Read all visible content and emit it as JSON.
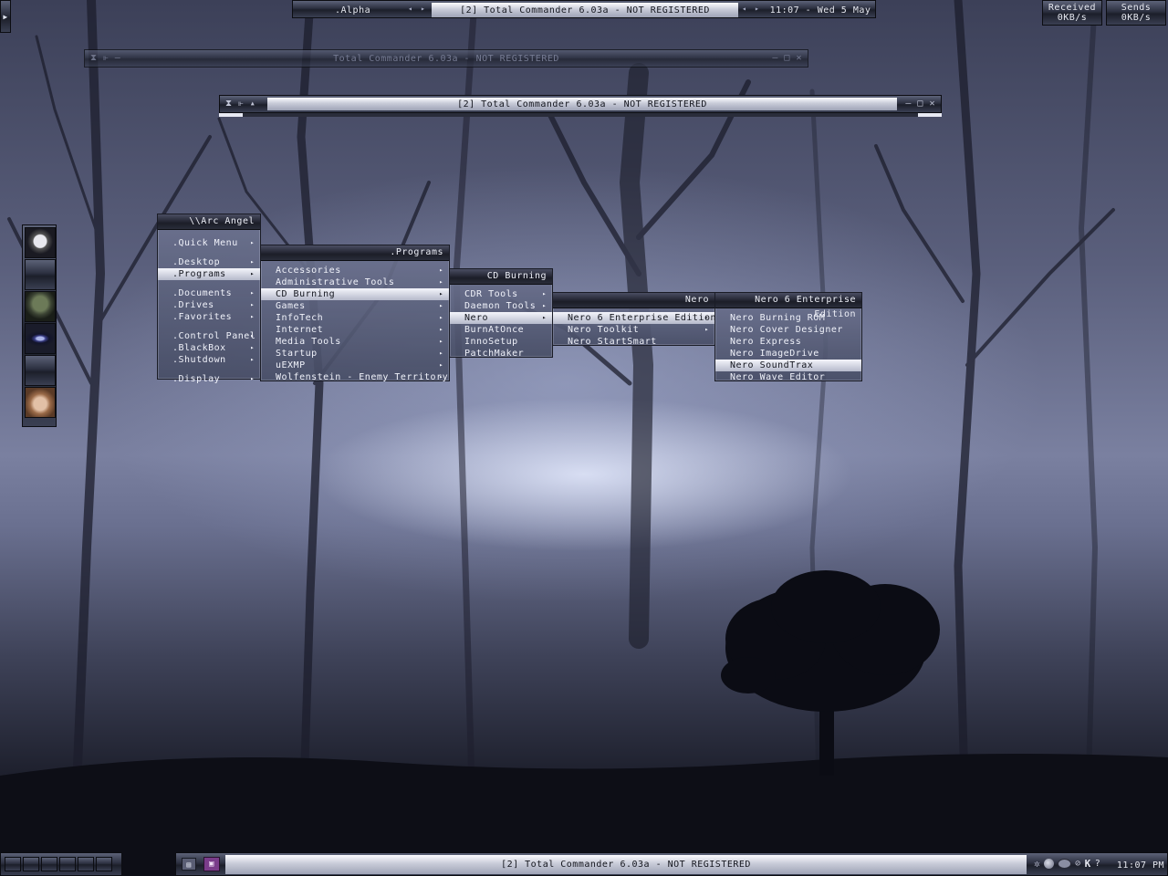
{
  "top_bar": {
    "workspace": ".Alpha",
    "window_title": "[2] Total Commander 6.03a - NOT REGISTERED",
    "clock": "11:07 - Wed 5 May"
  },
  "network": {
    "received_label": "Received",
    "received_value": "0KB/s",
    "sends_label": "Sends",
    "sends_value": "0KB/s"
  },
  "windows": [
    {
      "title": "Total Commander 6.03a - NOT REGISTERED"
    },
    {
      "title": "[2] Total Commander 6.03a - NOT REGISTERED"
    }
  ],
  "menus": {
    "root": {
      "title": "\\\\Arc Angel",
      "groups": [
        [
          {
            "label": ".Quick Menu"
          }
        ],
        [
          {
            "label": ".Desktop"
          },
          {
            "label": ".Programs"
          }
        ],
        [
          {
            "label": ".Documents"
          },
          {
            "label": ".Drives"
          },
          {
            "label": ".Favorites"
          }
        ],
        [
          {
            "label": ".Control Panel"
          },
          {
            "label": ".BlackBox"
          },
          {
            "label": ".Shutdown"
          }
        ],
        [
          {
            "label": ".Display"
          }
        ]
      ]
    },
    "programs": {
      "title": ".Programs",
      "items": [
        "Accessories",
        "Administrative Tools",
        "CD Burning",
        "Games",
        "InfoTech",
        "Internet",
        "Media Tools",
        "Startup",
        "uEXMP",
        "Wolfenstein - Enemy Territory"
      ]
    },
    "cd_burning": {
      "title": "CD Burning",
      "items": [
        "CDR Tools",
        "Daemon Tools",
        "Nero",
        "BurnAtOnce",
        "InnoSetup",
        "PatchMaker"
      ]
    },
    "nero": {
      "title": "Nero",
      "items": [
        "Nero 6 Enterprise Edition",
        "Nero Toolkit",
        "Nero StartSmart"
      ]
    },
    "nero6": {
      "title": "Nero 6 Enterprise Edition",
      "items": [
        "Nero Burning ROM",
        "Nero Cover Designer",
        "Nero Express",
        "Nero ImageDrive",
        "Nero SoundTrax",
        "Nero Wave Editor"
      ]
    }
  },
  "bottom_bar": {
    "window_title": "[2] Total Commander 6.03a - NOT REGISTERED",
    "clock": "11:07 PM",
    "help": "?"
  }
}
